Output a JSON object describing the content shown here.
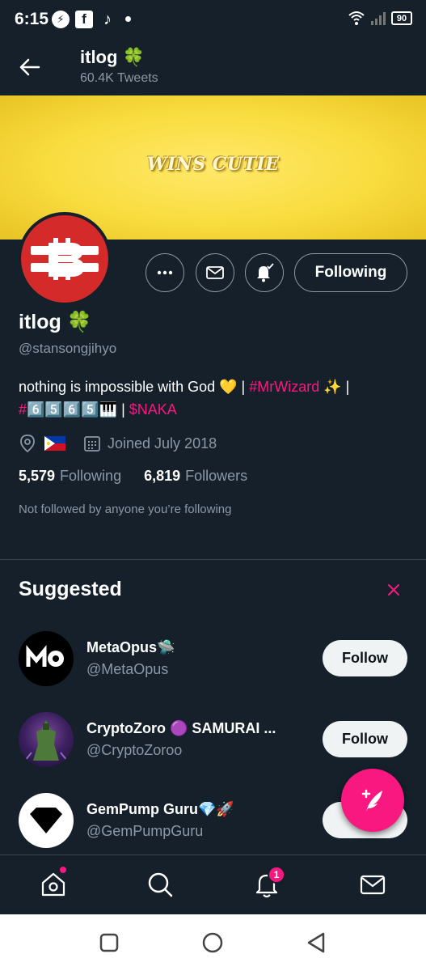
{
  "status_bar": {
    "time": "6:15",
    "battery": "90"
  },
  "header": {
    "name": "itlog",
    "tweets": "60.4K Tweets"
  },
  "banner": {
    "text": "WINS CUTIE",
    "colors": {
      "base": "#f9dc3e",
      "highlight": "#ffe86a"
    }
  },
  "profile": {
    "name": "itlog",
    "emoji": "🍀",
    "handle": "@stansongjihyo",
    "bio_line1_text": "nothing is impossible with God 💛 | ",
    "bio_line1_link": "#MrWizard",
    "bio_line1_tail": " ✨ |",
    "bio_line2_link": "#6️⃣5️⃣6️⃣5️⃣",
    "bio_line2_piano": "🎹",
    "bio_line2_sep": " | ",
    "bio_line2_cashtag": "$NAKA",
    "joined": "Joined July 2018",
    "following_count": "5,579",
    "following_label": "Following",
    "followers_count": "6,819",
    "followers_label": "Followers",
    "not_followed": "Not followed by anyone you’re following",
    "following_button": "Following"
  },
  "suggested": {
    "title": "Suggested",
    "accounts": [
      {
        "name": "MetaOpus🛸",
        "handle": "@MetaOpus",
        "button": "Follow"
      },
      {
        "name": "CryptoZoro 🟣 SAMURAI ...",
        "handle": "@CryptoZoroo",
        "button": "Follow"
      },
      {
        "name": "GemPump Guru💎🚀",
        "handle": "@GemPumpGuru",
        "button": "F"
      }
    ]
  },
  "nav": {
    "notification_count": "1"
  },
  "colors": {
    "background": "#15202b",
    "accent": "#f91880",
    "muted": "#8b98a5",
    "avatar_red": "#d42a2a"
  },
  "icons": [
    "back-arrow-icon",
    "more-icon",
    "mail-icon",
    "bell-plus-icon",
    "location-icon",
    "calendar-icon",
    "close-icon",
    "compose-feather-icon",
    "home-icon",
    "search-icon",
    "bell-icon",
    "mail-icon"
  ]
}
